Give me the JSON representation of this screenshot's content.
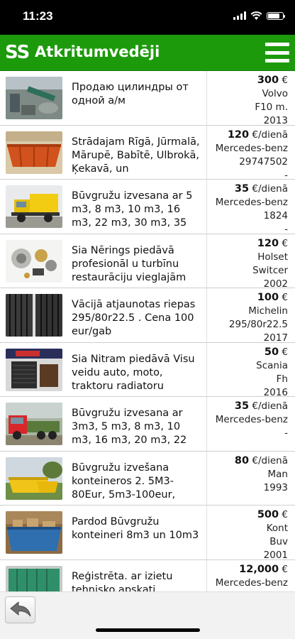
{
  "status_bar": {
    "time": "11:23"
  },
  "header": {
    "logo": "SS",
    "title": "Atkritumvedēji"
  },
  "listings": [
    {
      "description": "Продаю цилиндры от одной а/м",
      "price": "300",
      "unit": " €",
      "line1": "Volvo",
      "line2": "F10 m.",
      "line3": "2013"
    },
    {
      "description": "Strādajam Rīgā, Jūrmalā, Mārupē, Babītē, Ulbrokā, Ķekavā, un",
      "price": "120",
      "unit": " €/dienā",
      "line1": "Mercedes-benz",
      "line2": "29747502",
      "line3": "-"
    },
    {
      "description": "Būvgružu izvesana ar 5 m3, 8 m3, 10 m3, 16 m3, 22 m3, 30 m3, 35",
      "price": "35",
      "unit": " €/dienā",
      "line1": "Mercedes-benz",
      "line2": "1824",
      "line3": "-"
    },
    {
      "description": "Sia Nērings piedāvā profesionāl u turbīnu restaurāciju vieglajām",
      "price": "120",
      "unit": " €",
      "line1": "Holset",
      "line2": "Switcer",
      "line3": "2002"
    },
    {
      "description": "Vācijā atjaunotas riepas 295/80r22.5 . Cena 100 eur/gab",
      "price": "100",
      "unit": " €",
      "line1": "Michelin",
      "line2": "295/80r22.5",
      "line3": "2017"
    },
    {
      "description": "Sia Nitram piedāvā Visu veidu auto, moto, traktoru radiatoru",
      "price": "50",
      "unit": " €",
      "line1": "Scania",
      "line2": "Fh",
      "line3": "2016"
    },
    {
      "description": "Būvgružu izvesana ar 3m3, 5 m3, 8 m3, 10 m3, 16 m3, 20 m3, 22",
      "price": "35",
      "unit": " €/dienā",
      "line1": "Mercedes-benz",
      "line2": "-",
      "line3": ""
    },
    {
      "description": "Būvgružu izvešana konteineros 2. 5M3-80Eur, 5m3-100eur,",
      "price": "80",
      "unit": " €/dienā",
      "line1": "Man",
      "line2": "1993",
      "line3": ""
    },
    {
      "description": "Pardod Būvgružu konteineri 8m3 un 10m3",
      "price": "500",
      "unit": " €",
      "line1": "Kont",
      "line2": "Buv",
      "line3": "2001"
    },
    {
      "description": "Reģistrēta. ar izietu tehnisko apskati.",
      "price": "12,000",
      "unit": " €",
      "line1": "Mercedes-benz",
      "line2": "",
      "line3": ""
    }
  ],
  "colors": {
    "header_green": "#1d9a0c"
  },
  "icons": {
    "menu": "hamburger-menu-icon",
    "back": "back-arrow-icon"
  }
}
